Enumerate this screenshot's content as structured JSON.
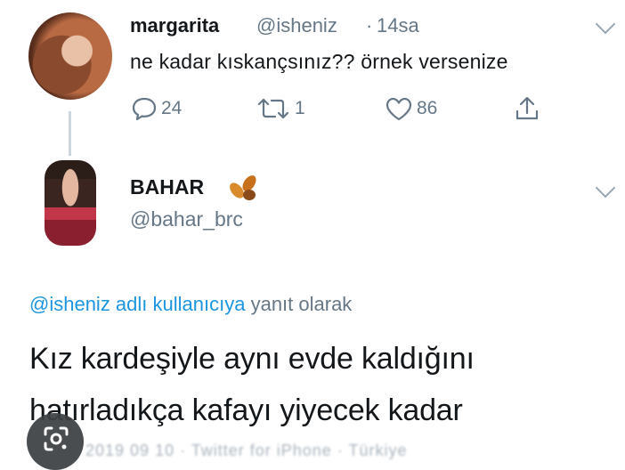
{
  "tweet1": {
    "name": "margarita",
    "handle": "@isheniz",
    "separator": "·",
    "time": "14sa",
    "text": "ne kadar kıskançsınız?? örnek versenize",
    "replies": "24",
    "retweets": "1",
    "likes": "86"
  },
  "tweet2": {
    "name": "BAHAR",
    "handle": "@bahar_brc",
    "replying_mention": "@isheniz adlı kullanıcıya",
    "replying_suffix": "yanıt olarak",
    "body_line1": "Kız kardeşiyle aynı evde kaldığını",
    "body_line2": "hatırladıkça kafayı yiyecek kadar",
    "cutoff_text": "2019 09 10 · Twitter for iPhone · Türkiye"
  },
  "icons": {
    "reply": "comment-icon",
    "retweet": "retweet-icon",
    "like": "heart-icon",
    "share": "share-icon",
    "menu": "chevron-down-icon",
    "emoji": "leaf-emoji-icon",
    "lens": "google-lens-icon"
  },
  "colors": {
    "text": "#14171a",
    "secondary": "#657786",
    "link": "#1b95e0",
    "thread_line": "#ccd6dd"
  }
}
